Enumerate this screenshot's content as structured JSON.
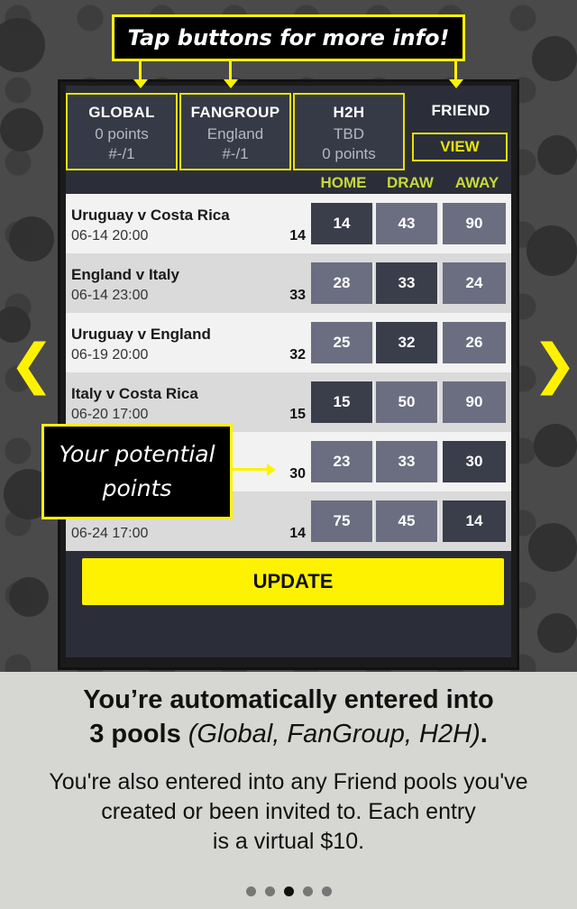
{
  "callout_top": "Tap buttons for more info!",
  "callout_points_line1": "Your potential",
  "callout_points_line2": "points",
  "pools": [
    {
      "title": "GLOBAL",
      "line1": "0 points",
      "line2": "#-/1"
    },
    {
      "title": "FANGROUP",
      "line1": "England",
      "line2": "#-/1"
    },
    {
      "title": "H2H",
      "line1": "TBD",
      "line2": "0 points"
    },
    {
      "title": "FRIEND",
      "button": "VIEW"
    }
  ],
  "columns": {
    "home": "HOME",
    "draw": "DRAW",
    "away": "AWAY"
  },
  "matches": [
    {
      "teams": "Uruguay v Costa Rica",
      "time": "06-14 20:00",
      "points": "14",
      "home": "14",
      "draw": "43",
      "away": "90"
    },
    {
      "teams": "England v Italy",
      "time": "06-14 23:00",
      "points": "33",
      "home": "28",
      "draw": "33",
      "away": "24"
    },
    {
      "teams": "Uruguay v England",
      "time": "06-19 20:00",
      "points": "32",
      "home": "25",
      "draw": "32",
      "away": "26"
    },
    {
      "teams": "Italy v Costa Rica",
      "time": "06-20 17:00",
      "points": "15",
      "home": "15",
      "draw": "50",
      "away": "90"
    },
    {
      "teams": "",
      "time": "",
      "points": "30",
      "home": "23",
      "draw": "33",
      "away": "30"
    },
    {
      "teams": "",
      "time": "06-24 17:00",
      "points": "14",
      "home": "75",
      "draw": "45",
      "away": "14"
    }
  ],
  "update_label": "UPDATE",
  "nav": {
    "prev": "❮",
    "next": "❯"
  },
  "headline_line1": "You’re automatically entered into",
  "headline_line2_bold": "3 pools ",
  "headline_line2_italic": "(Global, FanGroup, H2H)",
  "headline_line2_end": ".",
  "body_line1": "You're also entered into any Friend pools you've",
  "body_line2": "created or been invited to. Each entry",
  "body_line3": "is a virtual $10.",
  "pagination": {
    "total": 5,
    "active_index": 2
  },
  "colors": {
    "accent": "#fff200",
    "selected_odd": "#3a3d4a",
    "odd": "#6a6e80"
  }
}
